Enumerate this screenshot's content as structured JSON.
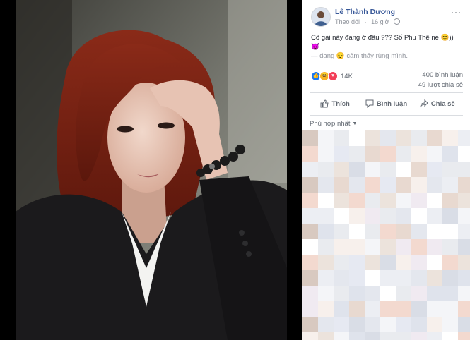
{
  "post": {
    "author": "Lê Thành Dương",
    "follow_label": "Theo dõi",
    "time": "16 giờ",
    "caption_line1": "Cô gái này đang ở đâu ??? Số Phu Thê nè 😊)) 😈",
    "caption_line2": "— đang 😌 cảm thấy rùng mình.",
    "reaction_count": "14K",
    "comments_count": "400 bình luận",
    "shares_count": "49 lượt chia sẻ",
    "actions": {
      "like": "Thích",
      "comment": "Bình luận",
      "share": "Chia sẻ"
    },
    "sort_label": "Phù hợp nhất"
  },
  "icons": [
    "globe-icon",
    "more-options-icon",
    "like-icon",
    "comment-icon",
    "share-icon",
    "caret-down-icon"
  ],
  "colors": {
    "author": "#385898",
    "like_blue": "#1877f2",
    "love_red": "#f33e58",
    "haha_yellow": "#f7b125"
  }
}
